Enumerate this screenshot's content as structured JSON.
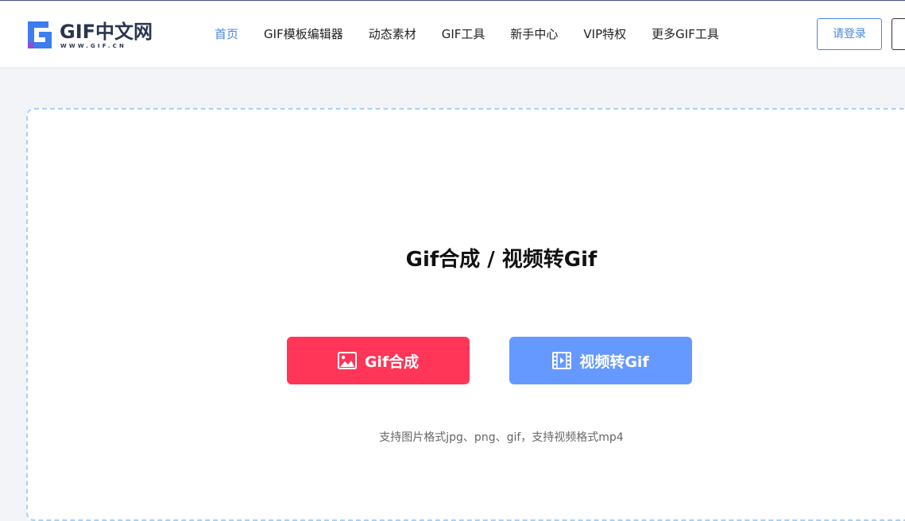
{
  "header": {
    "logo_text": "GIF中文网",
    "logo_sub": "WWW.GIF.CN",
    "nav": [
      {
        "label": "首页",
        "active": true
      },
      {
        "label": "GIF模板编辑器",
        "active": false
      },
      {
        "label": "动态素材",
        "active": false
      },
      {
        "label": "GIF工具",
        "active": false
      },
      {
        "label": "新手中心",
        "active": false
      },
      {
        "label": "VIP特权",
        "active": false
      },
      {
        "label": "更多GIF工具",
        "active": false
      }
    ],
    "login_label": "请登录"
  },
  "main": {
    "title": "Gif合成 / 视频转Gif",
    "gif_button_label": "Gif合成",
    "video_button_label": "视频转Gif",
    "hint": "支持图片格式jpg、png、gif，支持视频格式mp4"
  },
  "colors": {
    "accent": "#4a86e8",
    "gif_button": "#ff3658",
    "video_button": "#6699ff",
    "dashed_border": "#a9d1f5"
  },
  "icons": {
    "gif_button": "image-icon",
    "video_button": "film-icon"
  }
}
